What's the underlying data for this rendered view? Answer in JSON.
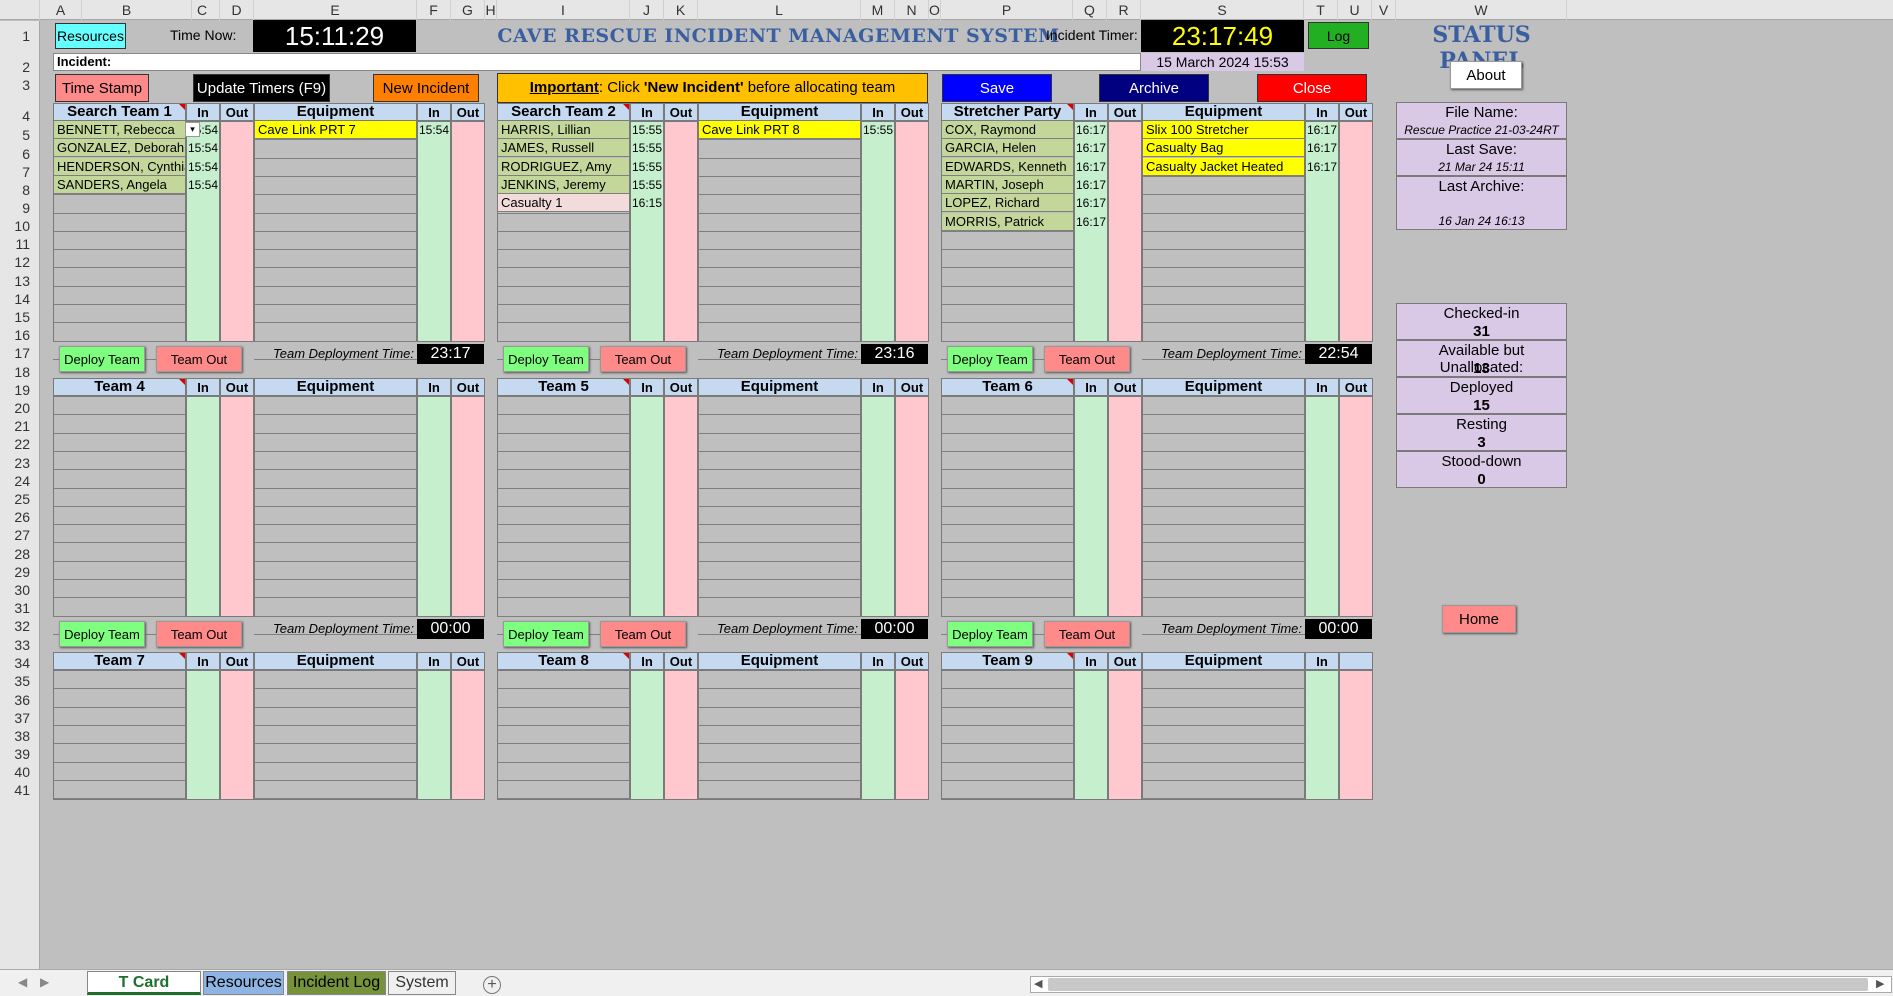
{
  "columns": [
    "A",
    "B",
    "C",
    "D",
    "E",
    "F",
    "G",
    "H",
    "I",
    "J",
    "K",
    "L",
    "M",
    "N",
    "O",
    "P",
    "Q",
    "R",
    "S",
    "T",
    "U",
    "V",
    "W"
  ],
  "row_numbers": [
    "1",
    "2",
    "3",
    "4",
    "5",
    "6",
    "7",
    "8",
    "9",
    "10",
    "11",
    "12",
    "13",
    "14",
    "15",
    "16",
    "17",
    "18",
    "19",
    "20",
    "21",
    "22",
    "23",
    "24",
    "25",
    "26",
    "27",
    "28",
    "29",
    "30",
    "31",
    "32",
    "33",
    "34",
    "35",
    "36",
    "37",
    "38",
    "39",
    "40",
    "41"
  ],
  "header": {
    "resources_btn": "Resources",
    "time_now_label": "Time Now:",
    "time_now": "15:11:29",
    "title": "CAVE RESCUE INCIDENT MANAGEMENT SYSTEM",
    "incident_timer_label": "Incident Timer:",
    "incident_timer": "23:17:49",
    "log_btn": "Log",
    "status_panel": "STATUS PANEL",
    "incident_label": "Incident:",
    "incident_date": "15 March 2024 15:53",
    "about_btn": "About",
    "time_stamp_btn": "Time Stamp",
    "update_timers_btn": "Update Timers (F9)",
    "new_incident_btn": "New Incident",
    "important_label": "Important",
    "important_text_pre": ": Click ",
    "important_quote": "'New Incident'",
    "important_text_post": " before allocating team members.",
    "save_btn": "Save",
    "archive_btn": "Archive",
    "close_btn": "Close"
  },
  "labels": {
    "in": "In",
    "out": "Out",
    "equipment": "Equipment",
    "deploy_team": "Deploy Team",
    "team_out": "Team Out",
    "team_deployment_time": "Team Deployment Time:"
  },
  "teams": [
    {
      "name": "Search Team 1",
      "members": [
        {
          "name": "BENNETT, Rebecca",
          "in": "15:54"
        },
        {
          "name": "GONZALEZ, Deborah",
          "in": "15:54"
        },
        {
          "name": "HENDERSON, Cynthia",
          "in": "15:54"
        },
        {
          "name": "SANDERS, Angela",
          "in": "15:54"
        }
      ],
      "equipment": [
        {
          "name": "Cave Link PRT 7",
          "in": "15:54"
        }
      ],
      "deploy_time": "23:17"
    },
    {
      "name": "Search Team 2",
      "members": [
        {
          "name": "HARRIS, Lillian",
          "in": "15:55"
        },
        {
          "name": "JAMES, Russell",
          "in": "15:55"
        },
        {
          "name": "RODRIGUEZ, Amy",
          "in": "15:55"
        },
        {
          "name": "JENKINS, Jeremy",
          "in": "15:55"
        },
        {
          "name": "Casualty 1",
          "in": "16:15",
          "casualty": true
        }
      ],
      "equipment": [
        {
          "name": "Cave Link PRT 8",
          "in": "15:55"
        }
      ],
      "deploy_time": "23:16"
    },
    {
      "name": "Stretcher Party",
      "members": [
        {
          "name": "COX, Raymond",
          "in": "16:17"
        },
        {
          "name": "GARCIA, Helen",
          "in": "16:17"
        },
        {
          "name": "EDWARDS, Kenneth",
          "in": "16:17"
        },
        {
          "name": "MARTIN, Joseph",
          "in": "16:17"
        },
        {
          "name": "LOPEZ, Richard",
          "in": "16:17"
        },
        {
          "name": "MORRIS, Patrick",
          "in": "16:17"
        }
      ],
      "equipment": [
        {
          "name": "Slix 100 Stretcher",
          "in": "16:17"
        },
        {
          "name": "Casualty Bag",
          "in": "16:17"
        },
        {
          "name": "Casualty Jacket Heated",
          "in": "16:17"
        }
      ],
      "deploy_time": "22:54"
    },
    {
      "name": "Team 4",
      "members": [],
      "equipment": [],
      "deploy_time": "00:00"
    },
    {
      "name": "Team 5",
      "members": [],
      "equipment": [],
      "deploy_time": "00:00"
    },
    {
      "name": "Team 6",
      "members": [],
      "equipment": [],
      "deploy_time": "00:00"
    },
    {
      "name": "Team 7",
      "members": [],
      "equipment": [],
      "deploy_time": ""
    },
    {
      "name": "Team 8",
      "members": [],
      "equipment": [],
      "deploy_time": ""
    },
    {
      "name": "Team 9",
      "members": [],
      "equipment": [],
      "deploy_time": ""
    }
  ],
  "status": {
    "file_name_label": "File Name:",
    "file_name": "Rescue Practice 21-03-24RT",
    "last_save_label": "Last Save:",
    "last_save": "21 Mar 24 15:11",
    "last_archive_label": "Last Archive:",
    "last_archive": "16 Jan 24 16:13",
    "counts": [
      {
        "label": "Checked-in",
        "value": "31"
      },
      {
        "label": "Available but Unallocated:",
        "value": "13"
      },
      {
        "label": "Deployed",
        "value": "15"
      },
      {
        "label": "Resting",
        "value": "3"
      },
      {
        "label": "Stood-down",
        "value": "0"
      }
    ],
    "home_btn": "Home"
  },
  "tabs": [
    "T Card System",
    "Resources",
    "Incident Log",
    "System"
  ],
  "colors": {
    "green": "#c6efce",
    "pink": "#ffc7ce",
    "header_blue": "#c5d9f1",
    "name_green": "#c4d79b",
    "equip_yellow": "#ffff00",
    "panel_purple": "#d9c8e6"
  }
}
